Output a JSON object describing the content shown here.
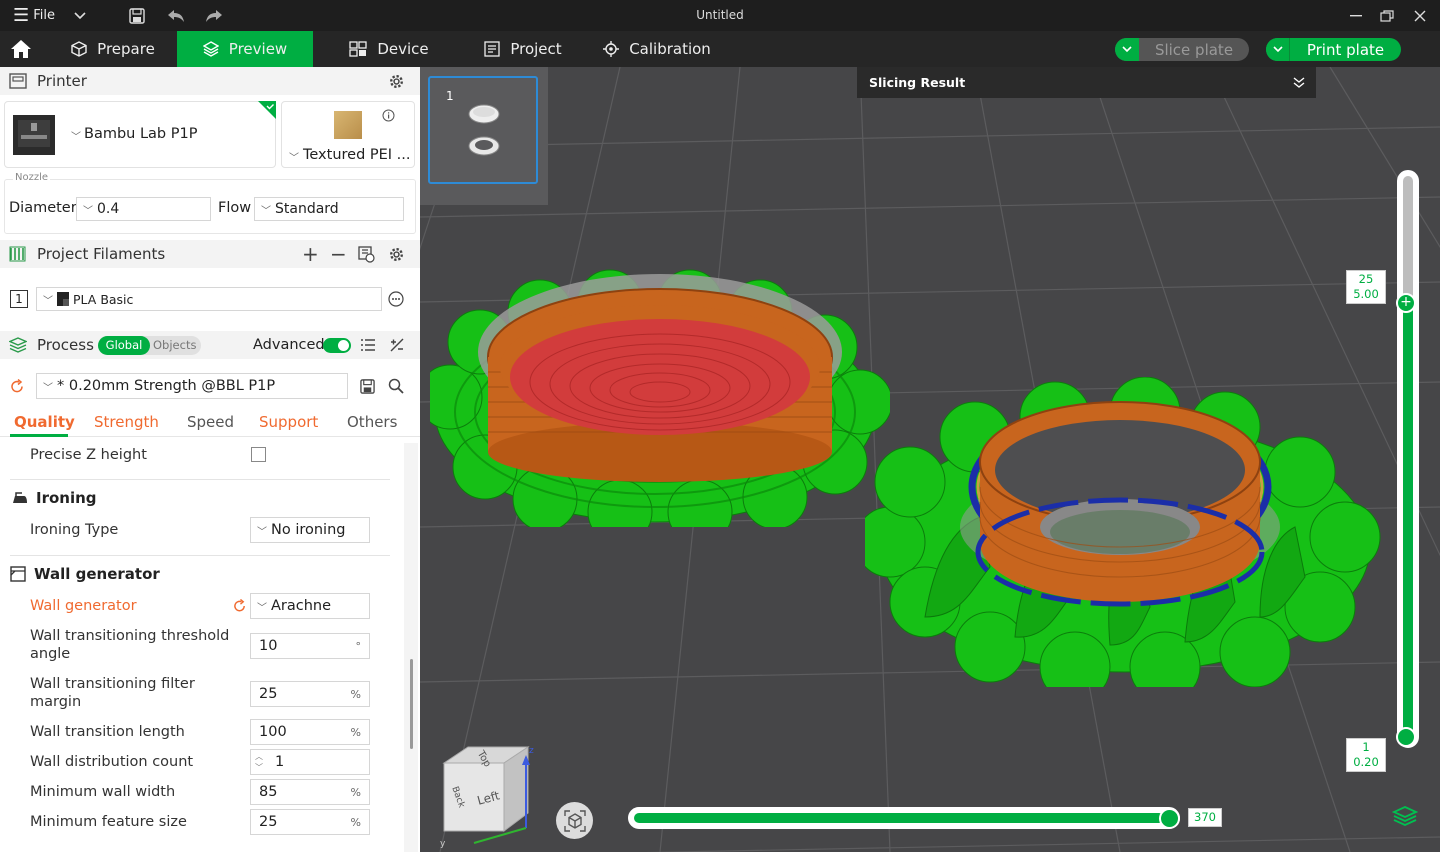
{
  "titlebar": {
    "file_label": "File",
    "title": "Untitled"
  },
  "tabs": [
    {
      "label": "Prepare",
      "icon": "cube-icon"
    },
    {
      "label": "Preview",
      "icon": "layers-icon"
    },
    {
      "label": "Device",
      "icon": "device-icon"
    },
    {
      "label": "Project",
      "icon": "project-icon"
    },
    {
      "label": "Calibration",
      "icon": "calibration-icon"
    }
  ],
  "actions": {
    "slice_plate": "Slice plate",
    "print_plate": "Print plate"
  },
  "printer": {
    "section_title": "Printer",
    "name": "Bambu Lab P1P",
    "plate": "Textured PEI ...",
    "nozzle_label": "Nozzle",
    "diameter_label": "Diameter",
    "diameter_value": "0.4",
    "flow_label": "Flow",
    "flow_value": "Standard"
  },
  "filaments": {
    "section_title": "Project Filaments",
    "items": [
      {
        "index": "1",
        "name": "PLA Basic"
      }
    ]
  },
  "process": {
    "section_title": "Process",
    "global_label": "Global",
    "objects_label": "Objects",
    "advanced_label": "Advanced",
    "preset": "* 0.20mm Strength @BBL P1P",
    "tabs": [
      "Quality",
      "Strength",
      "Speed",
      "Support",
      "Others"
    ]
  },
  "settings": {
    "precise_z": "Precise Z height",
    "ironing_group": "Ironing",
    "ironing_type_label": "Ironing Type",
    "ironing_type_value": "No ironing",
    "wall_group": "Wall generator",
    "wall_generator_label": "Wall generator",
    "wall_generator_value": "Arachne",
    "wt_angle_label": "Wall transitioning threshold angle",
    "wt_angle_value": "10",
    "wt_angle_unit": "°",
    "wt_filter_label": "Wall transitioning filter margin",
    "wt_filter_value": "25",
    "wt_filter_unit": "%",
    "wt_length_label": "Wall transition length",
    "wt_length_value": "100",
    "wt_length_unit": "%",
    "wd_count_label": "Wall distribution count",
    "wd_count_value": "1",
    "min_wall_label": "Minimum wall width",
    "min_wall_value": "85",
    "min_wall_unit": "%",
    "min_feature_label": "Minimum feature size",
    "min_feature_value": "25",
    "min_feature_unit": "%"
  },
  "viewport": {
    "plate_number": "1",
    "slicing_result": "Slicing Result",
    "layer_top_num": "25",
    "layer_top_height": "5.00",
    "layer_bottom_num": "1",
    "layer_bottom_height": "0.20",
    "move_value": "370",
    "cube_top": "Top",
    "cube_left": "Left",
    "cube_back": "Back"
  },
  "colors": {
    "accent": "#00ae42",
    "orange_label": "#f06a30",
    "viewport_bg": "#464648",
    "wall": "#c8651e",
    "infill": "#d23c3c",
    "support": "#16c016"
  }
}
